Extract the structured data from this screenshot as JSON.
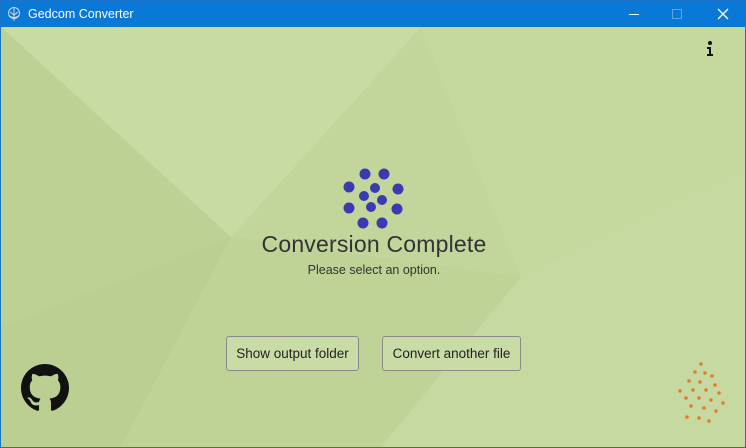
{
  "window": {
    "title": "Gedcom Converter",
    "controls": [
      "minimize",
      "maximize",
      "close"
    ]
  },
  "main": {
    "heading": "Conversion Complete",
    "subheading": "Please select an option.",
    "buttons": {
      "show_output": "Show output folder",
      "convert_another": "Convert another file"
    }
  },
  "icons": {
    "app": "family-tree-icon",
    "info": "info-icon",
    "spinner": "dots-spinner-icon",
    "github": "github-icon",
    "logo": "dots-logo-icon"
  },
  "colors": {
    "titlebar": "#0a78d7",
    "background": "#c2d59a",
    "spinner": "#3b3ab0",
    "logo_dots": "#e87b2a"
  }
}
